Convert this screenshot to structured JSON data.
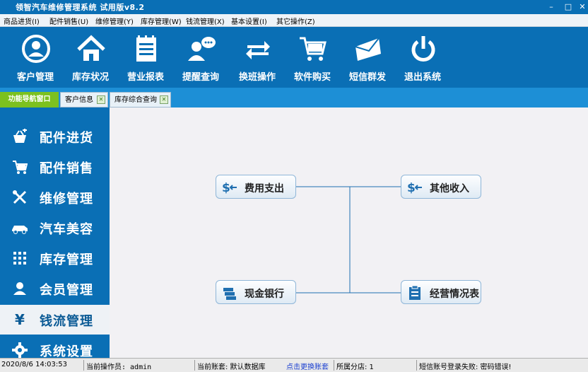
{
  "window": {
    "title": "领智汽车维修管理系统 试用版v8.2",
    "minimize": "–",
    "maximize": "□",
    "close": "✕"
  },
  "menu": [
    "商品进货(I)",
    "配件销售(U)",
    "维修管理(Y)",
    "库存管理(W)",
    "钱流管理(X)",
    "基本设置(I)",
    "其它操作(Z)"
  ],
  "toolbar": [
    "客户管理",
    "库存状况",
    "营业报表",
    "提醒查询",
    "换班操作",
    "软件购买",
    "短信群发",
    "退出系统"
  ],
  "tabs": {
    "nav": "功能导航窗口",
    "open": [
      "客户信息",
      "库存综合查询"
    ],
    "close_glyph": "✕"
  },
  "sidebar": [
    "配件进货",
    "配件销售",
    "维修管理",
    "汽车美容",
    "库存管理",
    "会员管理",
    "钱流管理",
    "系统设置"
  ],
  "sidebar_active": "钱流管理",
  "sidebar_yen": "¥",
  "flow": [
    "费用支出",
    "其他收入",
    "现金银行",
    "经营情况表"
  ],
  "flow_icon_text": "$",
  "status": {
    "datetime": "2020/8/6 14:03:53",
    "operator": "当前操作员: admin",
    "account": "当前账套: 默认数据库",
    "switch_link": "点击更换账套",
    "branch": "所属分店: 1",
    "sms": "短信账号登录失败: 密码错误!"
  },
  "colors": {
    "primary": "#0a6fb5",
    "tab_active": "#7cc11f",
    "link": "#1a3fd0"
  }
}
